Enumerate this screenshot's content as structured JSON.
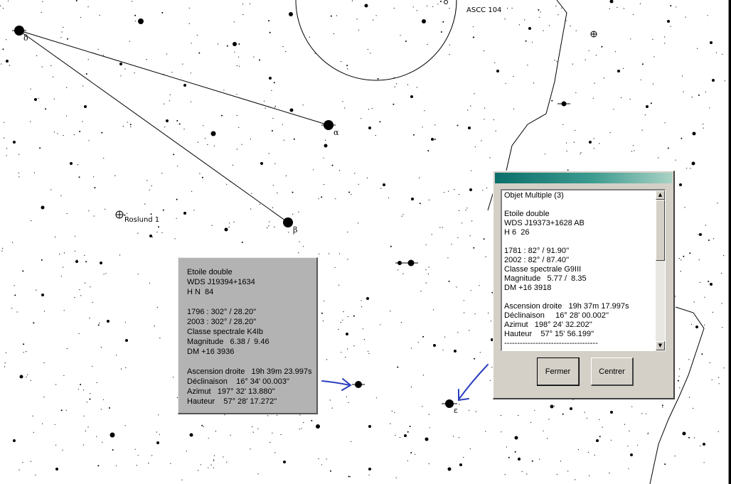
{
  "map": {
    "labels": {
      "ascc": "ASCC 104",
      "roslund": "Roslund 1",
      "delta": "δ",
      "alpha": "α",
      "beta": "β",
      "epsilon": "ε"
    },
    "colors": {
      "ink": "#000000",
      "arrow": "#2b3fbf"
    },
    "icons": {
      "cluster_marker": "circle-plus-icon",
      "pointer": "arrow-icon"
    }
  },
  "info_box": {
    "lines": [
      "Etoile double",
      "WDS J19394+1634",
      "H N  84",
      "",
      "1796 : 302° / 28.20''",
      "2003 : 302° / 28.20''",
      "Classe spectrale K4Ib",
      "Magnitude   6.38 /  9.46",
      "DM +16 3936",
      "",
      "Ascension droite   19h 39m 23.997s",
      "Déclinaison    16° 34' 00.003''",
      "Azimut   197° 32' 13.880''",
      "Hauteur    57° 28' 17.272''"
    ]
  },
  "dialog": {
    "title": "",
    "list_lines": [
      "Objet Multiple (3)",
      "",
      "Etoile double",
      "WDS J19373+1628 AB",
      "H 6  26",
      "",
      "1781 : 82° / 91.90''",
      "2002 : 82° / 87.40''",
      "Classe spectrale G9III",
      "Magnitude   5.77 /  8.35",
      "DM +16 3918",
      "",
      "Ascension droite   19h 37m 17.997s",
      "Déclinaison     16° 28' 00.002''",
      "Azimut   198° 24' 32.202''",
      "Hauteur    57° 15' 56.199''",
      "------------------------------------"
    ],
    "buttons": {
      "close": "Fermer",
      "center": "Centrer"
    },
    "scroll_arrows": {
      "up": "▲",
      "down": "▼"
    }
  }
}
